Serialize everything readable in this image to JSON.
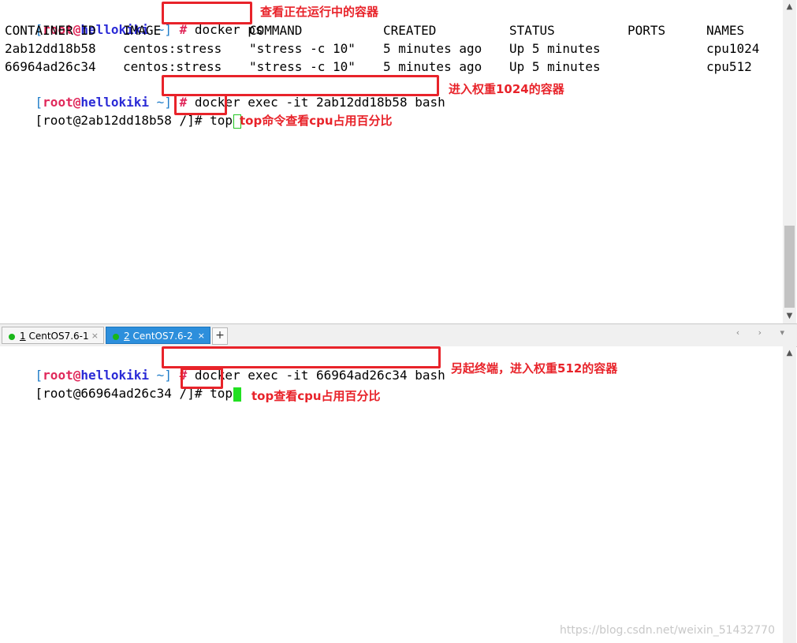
{
  "pane1": {
    "prompt1": {
      "open": "[",
      "user": "root",
      "at": "@",
      "host": "hellokiki",
      "path": " ~",
      "close": "]",
      "hash": " #",
      "cmd": " docker ps"
    },
    "headers": [
      "CONTAINER ID",
      "IMAGE",
      "COMMAND",
      "CREATED",
      "STATUS",
      "PORTS",
      "NAMES"
    ],
    "rows": [
      [
        "2ab12dd18b58",
        "centos:stress",
        "\"stress -c 10\"",
        "5 minutes ago",
        "Up 5 minutes",
        "",
        "cpu1024"
      ],
      [
        "66964ad26c34",
        "centos:stress",
        "\"stress -c 10\"",
        "5 minutes ago",
        "Up 5 minutes",
        "",
        "cpu512"
      ]
    ],
    "prompt2": {
      "open": "[",
      "user": "root",
      "at": "@",
      "host": "hellokiki",
      "path": " ~",
      "close": "]",
      "hash": " #",
      "cmd": " docker exec -it 2ab12dd18b58 bash"
    },
    "prompt3": {
      "text": "[root@2ab12dd18b58 /]#",
      "cmd": " top"
    },
    "notes": {
      "n1": "查看正在运行中的容器",
      "n2": "进入权重1024的容器",
      "n3": "top命令查看cpu占用百分比"
    }
  },
  "tabs": [
    {
      "num": "1",
      "label": " CentOS7.6-1",
      "close": "×",
      "status_color": "#19b619"
    },
    {
      "num": "2",
      "label": " CentOS7.6-2",
      "close": "×",
      "status_color": "#19b619"
    }
  ],
  "tabbar": {
    "add": "+",
    "nav": "‹ › ▾"
  },
  "pane2": {
    "prompt1": {
      "open": "[",
      "user": "root",
      "at": "@",
      "host": "hellokiki",
      "path": " ~",
      "close": "]",
      "hash": " #",
      "cmd": " docker exec -it 66964ad26c34 bash"
    },
    "prompt2": {
      "text": "[root@66964ad26c34 /]#",
      "cmd": " top"
    },
    "notes": {
      "n1": "另起终端，进入权重512的容器",
      "n2": "top查看cpu占用百分比"
    }
  },
  "watermark": "https://blog.csdn.net/weixin_51432770",
  "colors": {
    "annotation": "#e8232a",
    "tab_active": "#2d8fdc",
    "cursor": "#22e022"
  }
}
